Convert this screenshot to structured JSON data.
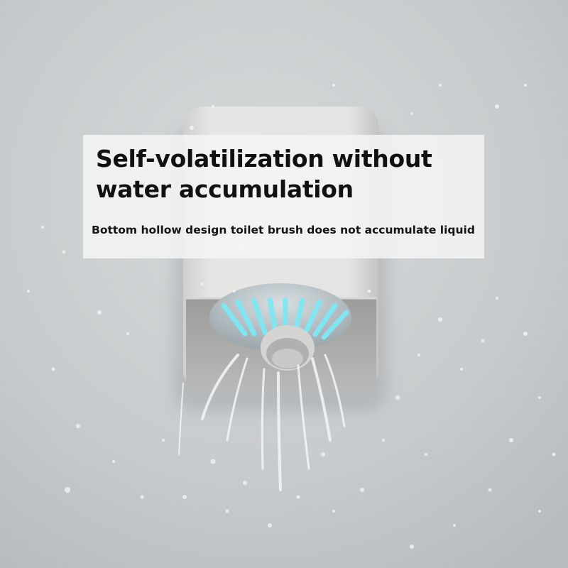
{
  "caption": {
    "headline": "Self-volatilization without water accumulation",
    "subline": "Bottom hollow design toilet brush does not accumulate liquid"
  },
  "colors": {
    "wall": "#c9ccce",
    "holder": "#e4e4e2",
    "brush_slot_glow": "#7ee8f4",
    "panel": "#f4f4f4",
    "text": "#111111"
  }
}
